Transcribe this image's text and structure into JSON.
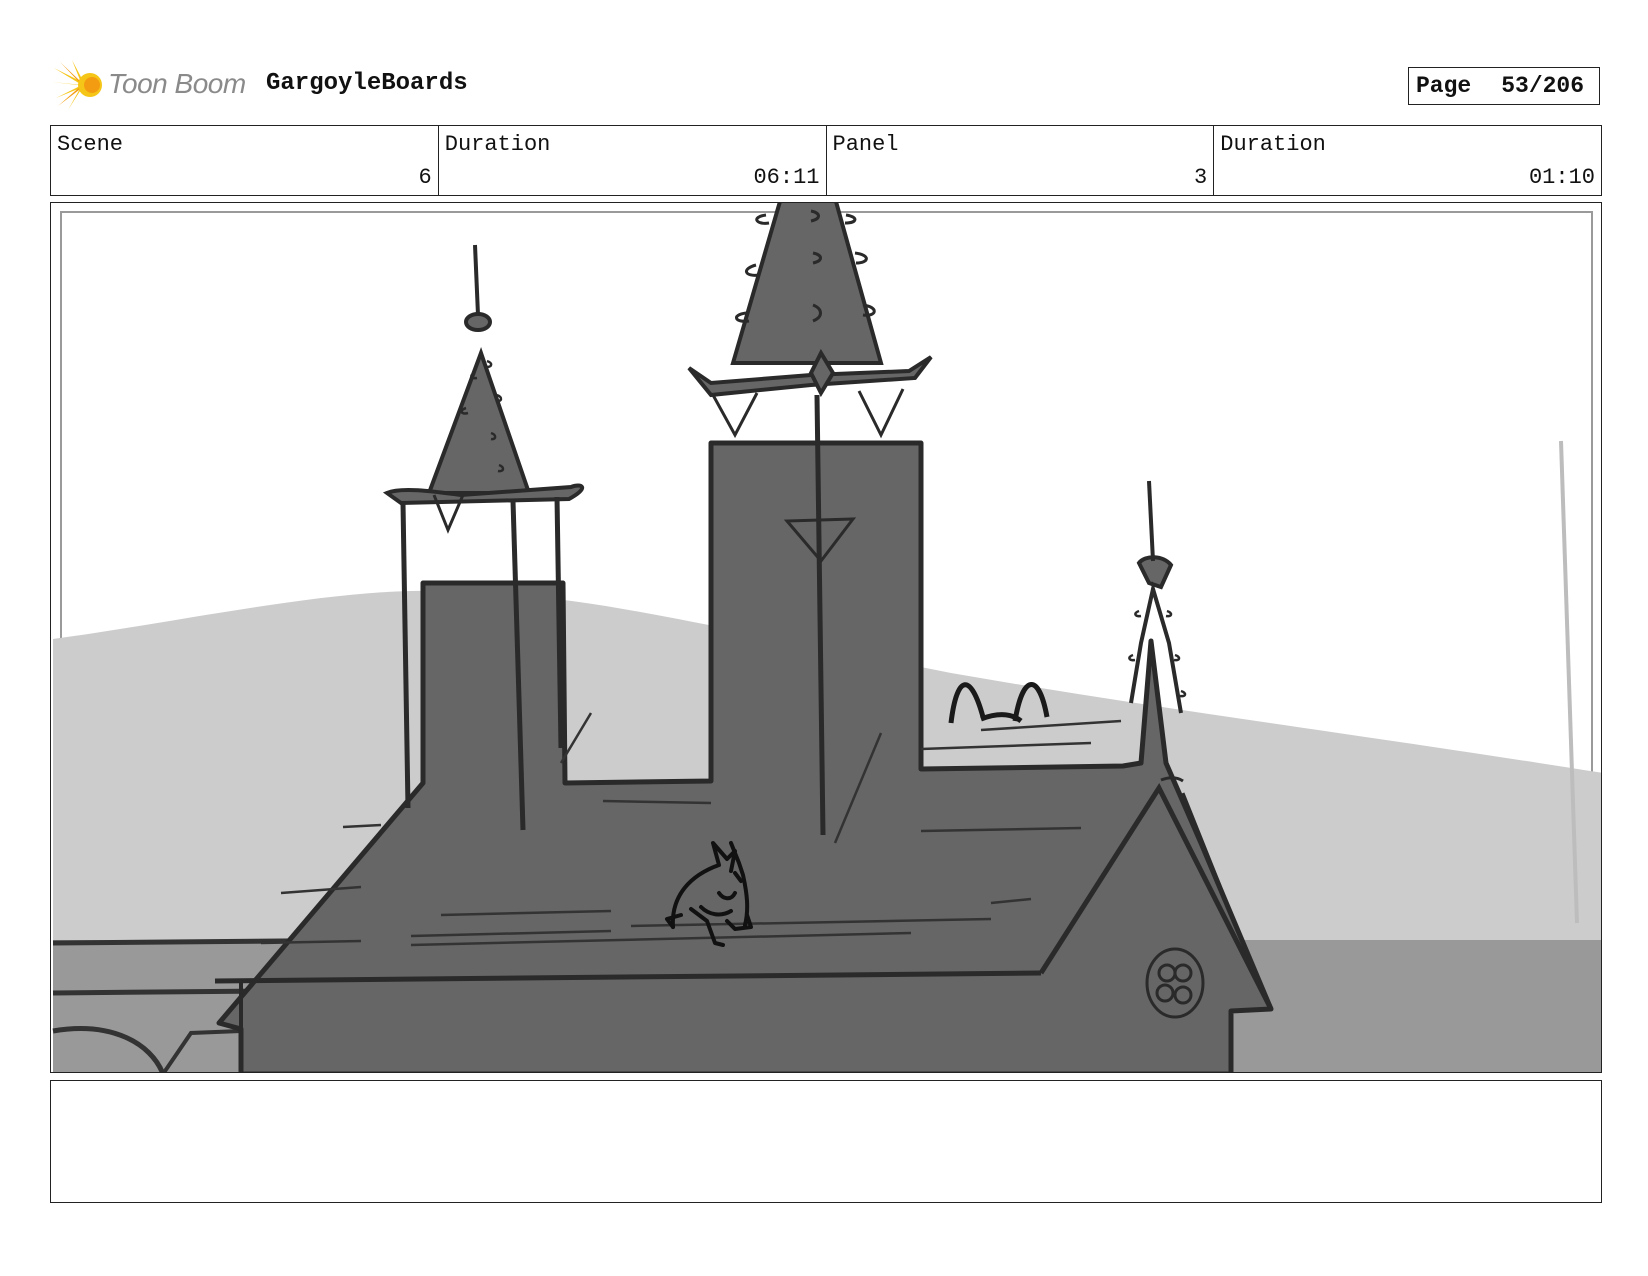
{
  "header": {
    "brand": "Toon Boom",
    "project": "GargoyleBoards",
    "page_label": "Page",
    "page_value": "53/206"
  },
  "info": {
    "scene_label": "Scene",
    "scene_value": "6",
    "scene_duration_label": "Duration",
    "scene_duration_value": "06:11",
    "panel_label": "Panel",
    "panel_value": "3",
    "panel_duration_label": "Duration",
    "panel_duration_value": "01:10"
  },
  "panel": {
    "image": "sketch-castle-rooftop-gargoyle"
  },
  "notes": {
    "text": ""
  },
  "colors": {
    "logo_yellow": "#f5c518",
    "logo_orange": "#f39c12",
    "building": "#666666",
    "hill": "#cccccc",
    "wall": "#999999",
    "line": "#2a2a2a"
  }
}
